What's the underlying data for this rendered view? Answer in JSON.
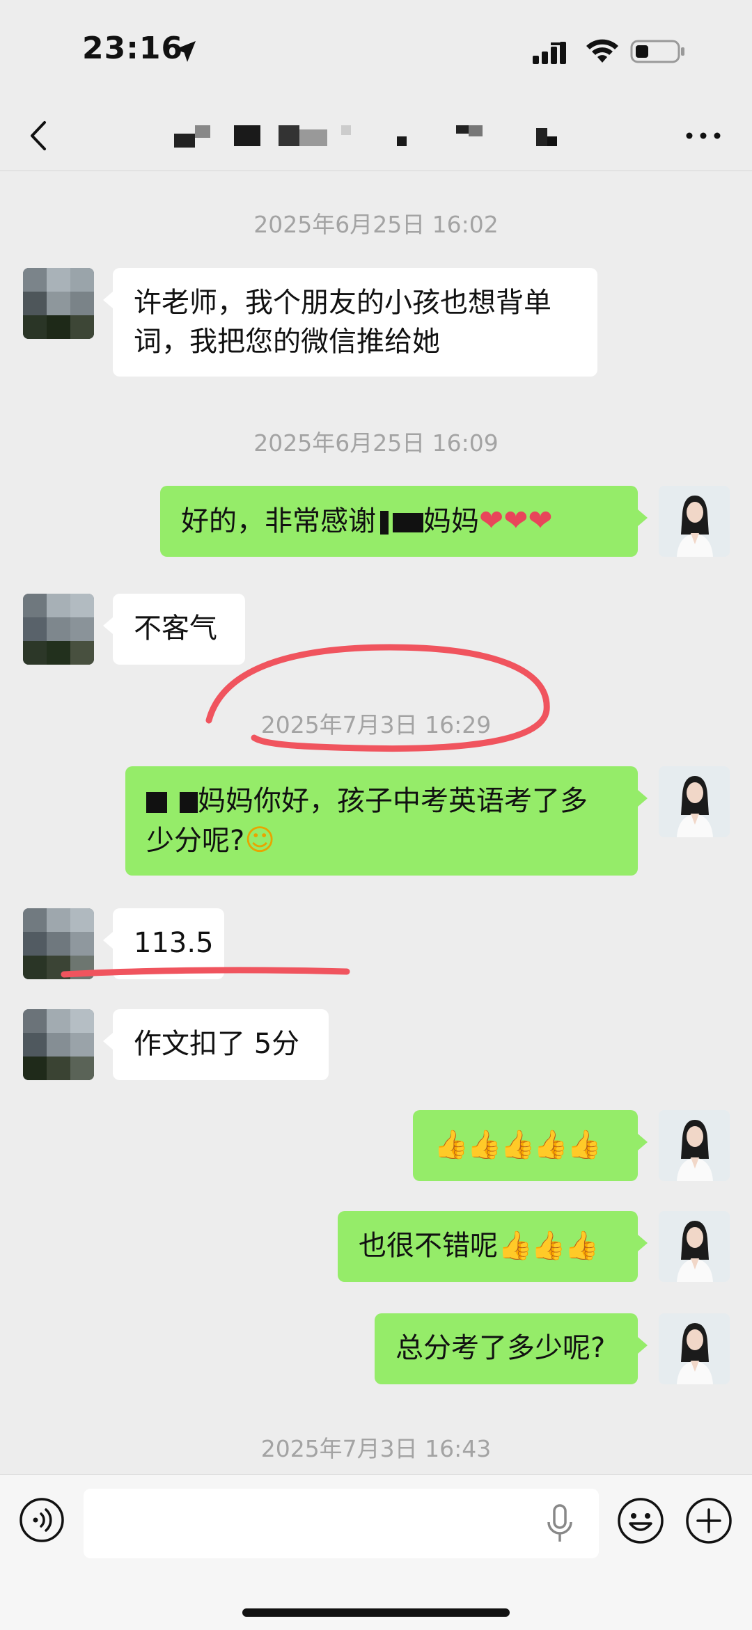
{
  "status_bar": {
    "time": "23:16"
  },
  "nav": {
    "title_hidden": true
  },
  "messages": [
    {
      "type": "timestamp",
      "text": "2025年6月25日 16:02"
    },
    {
      "type": "in",
      "lines": [
        "许老师，我个朋友的小孩也想背单",
        "词，我把您的微信推给她"
      ]
    },
    {
      "type": "timestamp",
      "text": "2025年6月25日 16:09"
    },
    {
      "type": "out",
      "before": "好的，非常感谢",
      "after": "妈妈",
      "emoji": "❤❤❤"
    },
    {
      "type": "in",
      "text": "不客气"
    },
    {
      "type": "timestamp",
      "text": "2025年7月3日 16:29"
    },
    {
      "type": "out",
      "line1_after": "妈妈你好，孩子中考英语考了多",
      "line2": "少分呢?",
      "emoji": "☺"
    },
    {
      "type": "in",
      "text": "113.5"
    },
    {
      "type": "in",
      "text": "作文扣了 5分"
    },
    {
      "type": "out",
      "emoji": "👍👍👍👍👍"
    },
    {
      "type": "out",
      "text": "也很不错呢",
      "emoji": "👍👍👍"
    },
    {
      "type": "out",
      "text": "总分考了多少呢?"
    },
    {
      "type": "timestamp",
      "text": "2025年7月3日 16:43"
    }
  ],
  "input_bar": {
    "placeholder": ""
  },
  "colors": {
    "outgoing_bubble": "#95ec69",
    "incoming_bubble": "#ffffff",
    "background": "#ededed",
    "annotation": "#f0545e"
  }
}
